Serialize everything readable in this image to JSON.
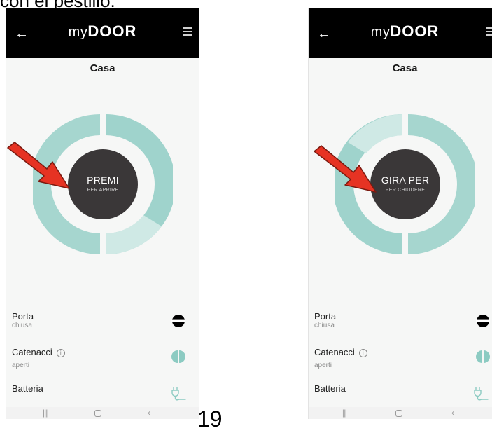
{
  "document": {
    "caption_fragment": "con el pestillo:",
    "page_number": "19"
  },
  "app": {
    "brand_prefix": "my",
    "brand_name": "DOOR",
    "back_glyph": "←",
    "page_title": "Casa"
  },
  "screens": [
    {
      "button_main": "PREMI",
      "button_sub": "PER APRIRE",
      "dial_state": "opening"
    },
    {
      "button_main": "GIRA PER",
      "button_sub": "PER CHIUDERE",
      "dial_state": "closing"
    }
  ],
  "status": {
    "porta_label": "Porta",
    "porta_value": "chiusa",
    "catenacci_label": "Catenacci",
    "catenacci_value": "aperti",
    "batteria_label": "Batteria",
    "info_glyph": "i"
  },
  "icons": {
    "back": "arrow-left-icon",
    "menu": "hamburger-menu-icon",
    "porta": "lock-closed-icon",
    "catenacci": "bolts-half-icon",
    "batteria": "plug-icon",
    "info": "info-icon",
    "pointer": "red-arrow-icon"
  },
  "nav": {
    "recents": "|||",
    "back": "‹"
  },
  "colors": {
    "teal": "#9fd3cc",
    "teal_light": "#cfe9e5",
    "dark_button": "#3a3738",
    "arrow_red": "#e63323",
    "appbar": "#000000"
  }
}
